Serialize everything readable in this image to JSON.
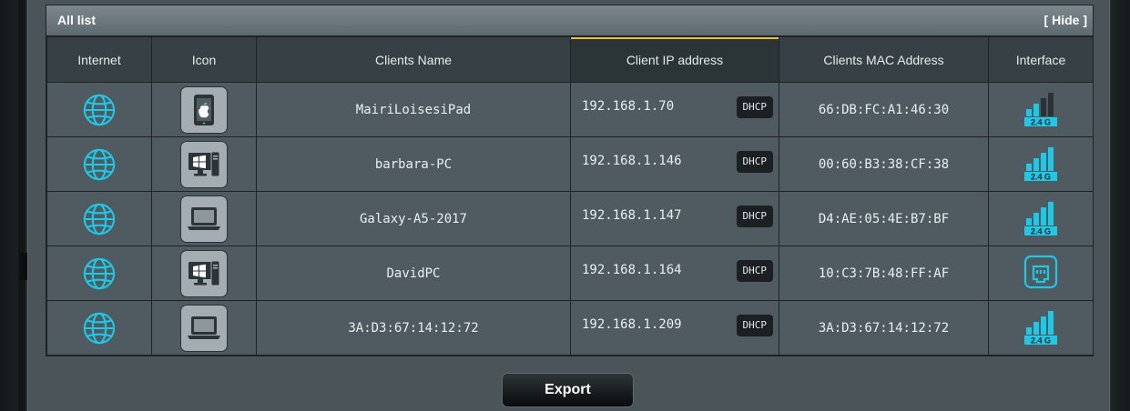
{
  "list": {
    "title": "All list",
    "hide_label": "[ Hide ]",
    "columns": [
      "Internet",
      "Icon",
      "Clients Name",
      "Client IP address",
      "Clients MAC Address",
      "Interface"
    ],
    "sorted_column": 3,
    "rows": [
      {
        "internet_icon": "globe-icon",
        "device_icon": "tablet-icon",
        "name": "MairiLoisesiPad",
        "ip": "192.168.1.70",
        "ip_type": "DHCP",
        "mac": "66:DB:FC:A1:46:30",
        "interface": "wifi",
        "band": "2.4 G",
        "signal_bars": 2
      },
      {
        "internet_icon": "globe-icon",
        "device_icon": "windows-pc-icon",
        "name": "barbara-PC",
        "ip": "192.168.1.146",
        "ip_type": "DHCP",
        "mac": "00:60:B3:38:CF:38",
        "interface": "wifi",
        "band": "2.4 G",
        "signal_bars": 4
      },
      {
        "internet_icon": "globe-icon",
        "device_icon": "laptop-icon",
        "name": "Galaxy-A5-2017",
        "ip": "192.168.1.147",
        "ip_type": "DHCP",
        "mac": "D4:AE:05:4E:B7:BF",
        "interface": "wifi",
        "band": "2.4 G",
        "signal_bars": 4
      },
      {
        "internet_icon": "globe-icon",
        "device_icon": "windows-pc-icon",
        "name": "DavidPC",
        "ip": "192.168.1.164",
        "ip_type": "DHCP",
        "mac": "10:C3:7B:48:FF:AF",
        "interface": "wired",
        "band": "",
        "signal_bars": 0
      },
      {
        "internet_icon": "globe-icon",
        "device_icon": "laptop-icon",
        "name": "3A:D3:67:14:12:72",
        "ip": "192.168.1.209",
        "ip_type": "DHCP",
        "mac": "3A:D3:67:14:12:72",
        "interface": "wifi",
        "band": "2.4 G",
        "signal_bars": 4
      }
    ]
  },
  "export_label": "Export",
  "colors": {
    "accent_cyan": "#1ec8e6",
    "sort_indicator": "#f2c230",
    "row_bg": "#4f5b61",
    "header_bg": "#374145"
  }
}
